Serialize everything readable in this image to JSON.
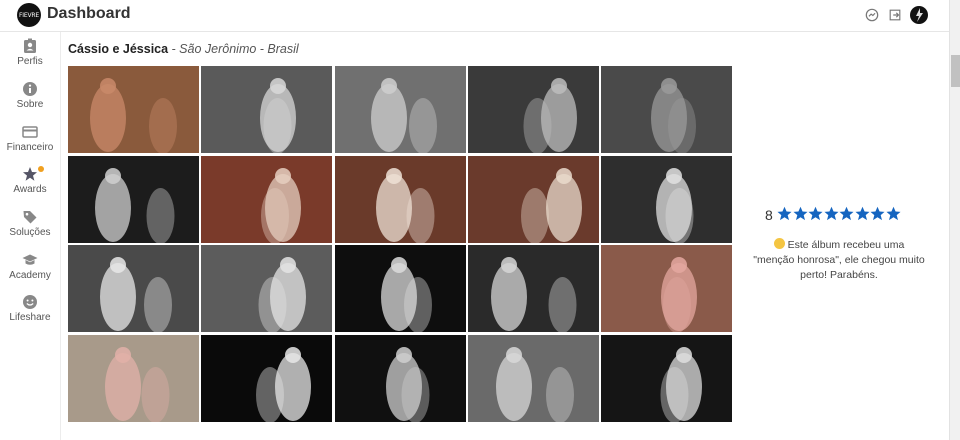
{
  "header": {
    "logo_text": "FIEVRE",
    "title": "Dashboard",
    "icons": [
      "messenger-icon",
      "logout-icon",
      "user-avatar"
    ]
  },
  "sidebar": {
    "items": [
      {
        "label": "Perfis",
        "icon": "id-badge-icon"
      },
      {
        "label": "Sobre",
        "icon": "info-icon"
      },
      {
        "label": "Financeiro",
        "icon": "credit-card-icon"
      },
      {
        "label": "Awards",
        "icon": "star-icon",
        "badge": true
      },
      {
        "label": "Soluções",
        "icon": "tag-icon"
      },
      {
        "label": "Academy",
        "icon": "graduation-cap-icon"
      },
      {
        "label": "Lifeshare",
        "icon": "smile-icon"
      }
    ]
  },
  "album": {
    "couple": "Cássio e Jéssica",
    "location": " - São Jerônimo - Brasil"
  },
  "photos": [
    {
      "tone": "#8a5a3c",
      "accent": "#c98a6a"
    },
    {
      "tone": "#5a5a5a",
      "accent": "#d8d8d8"
    },
    {
      "tone": "#707070",
      "accent": "#cfcfcf"
    },
    {
      "tone": "#3a3a3a",
      "accent": "#bdbdbd"
    },
    {
      "tone": "#4a4a4a",
      "accent": "#9a9a9a"
    },
    {
      "tone": "#1c1c1c",
      "accent": "#d0d0d0"
    },
    {
      "tone": "#7a3a2a",
      "accent": "#e6cfc0"
    },
    {
      "tone": "#6a3a2a",
      "accent": "#efe2d6"
    },
    {
      "tone": "#6a3a2c",
      "accent": "#eadbcc"
    },
    {
      "tone": "#2e2e2e",
      "accent": "#e0e0e0"
    },
    {
      "tone": "#4a4a4a",
      "accent": "#e8e8e8"
    },
    {
      "tone": "#5c5c5c",
      "accent": "#e4e4e4"
    },
    {
      "tone": "#0e0e0e",
      "accent": "#dcdcdc"
    },
    {
      "tone": "#2a2a2a",
      "accent": "#d6d6d6"
    },
    {
      "tone": "#8a5a4a",
      "accent": "#e4a8a0"
    },
    {
      "tone": "#a89a8a",
      "accent": "#e2b0a8"
    },
    {
      "tone": "#0a0a0a",
      "accent": "#e8e8e8"
    },
    {
      "tone": "#101010",
      "accent": "#cfcfcf"
    },
    {
      "tone": "#6a6a6a",
      "accent": "#d8d8d8"
    },
    {
      "tone": "#151515",
      "accent": "#dedede"
    }
  ],
  "rating": {
    "score": "8",
    "stars": 8,
    "star_color": "#1565c0",
    "message": "Este álbum recebeu uma \"menção honrosa\", ele chegou muito perto! Parabéns."
  }
}
